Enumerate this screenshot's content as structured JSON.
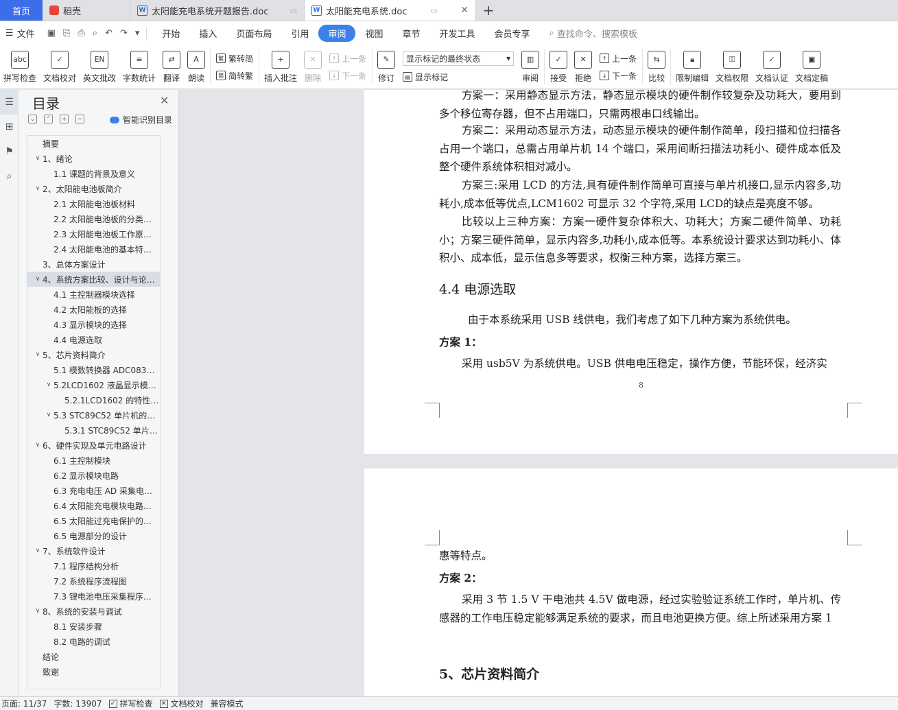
{
  "tabs": {
    "home": "首页",
    "tab1": "稻壳",
    "tab2": "太阳能充电系统开题报告.doc",
    "tab3": "太阳能充电系统.doc",
    "add": "+"
  },
  "menu": {
    "file": "文件",
    "items": [
      "开始",
      "插入",
      "页面布局",
      "引用",
      "审阅",
      "视图",
      "章节",
      "开发工具",
      "会员专享"
    ],
    "active_index": 4,
    "search": "查找命令、搜索模板"
  },
  "ribbon": {
    "spell": "拼写检查",
    "doc_check": "文档校对",
    "en_review": "英文批改",
    "word_count": "字数统计",
    "translate": "翻译",
    "read": "朗读",
    "to_trad": "繁转简",
    "to_simp": "简转繁",
    "insert_comment": "插入批注",
    "delete": "删除",
    "prev1": "上一条",
    "next1": "下一条",
    "revise": "修订",
    "markup_select": "显示标记的最终状态",
    "show_markup": "显示标记",
    "review": "审阅",
    "accept": "接受",
    "reject": "拒绝",
    "prev2": "上一条",
    "next2": "下一条",
    "compare": "比较",
    "restrict": "限制编辑",
    "doc_rights": "文档权限",
    "doc_cert": "文档认证",
    "doc_final": "文档定稿"
  },
  "toc": {
    "title": "目录",
    "smart": "智能识别目录",
    "items": [
      {
        "text": "摘要",
        "level": 1,
        "arrow": ""
      },
      {
        "text": "1、绪论",
        "level": 1,
        "arrow": "v"
      },
      {
        "text": "1.1 课题的背景及意义",
        "level": 2,
        "arrow": ""
      },
      {
        "text": "2、太阳能电池板简介",
        "level": 1,
        "arrow": "v"
      },
      {
        "text": "2.1 太阳能电池板材料",
        "level": 2,
        "arrow": ""
      },
      {
        "text": "2.2 太阳能电池板的分类…",
        "level": 2,
        "arrow": ""
      },
      {
        "text": "2.3 太阳能电池板工作原…",
        "level": 2,
        "arrow": ""
      },
      {
        "text": "2.4 太阳能电池的基本特…",
        "level": 2,
        "arrow": ""
      },
      {
        "text": "3、总体方案设计",
        "level": 1,
        "arrow": ""
      },
      {
        "text": "4、系统方案比较、设计与论…",
        "level": 1,
        "arrow": "v",
        "active": true
      },
      {
        "text": "4.1 主控制器模块选择",
        "level": 2,
        "arrow": ""
      },
      {
        "text": "4.2 太阳能板的选择",
        "level": 2,
        "arrow": ""
      },
      {
        "text": "4.3 显示模块的选择",
        "level": 2,
        "arrow": ""
      },
      {
        "text": "4.4 电源选取",
        "level": 2,
        "arrow": ""
      },
      {
        "text": "5、芯片资料简介",
        "level": 1,
        "arrow": "v"
      },
      {
        "text": "5.1 模数转换器 ADC083…",
        "level": 2,
        "arrow": ""
      },
      {
        "text": "5.2LCD1602 液晶显示模…",
        "level": 2,
        "arrow": "v"
      },
      {
        "text": "5.2.1LCD1602 的特性…",
        "level": 3,
        "arrow": ""
      },
      {
        "text": "5.3 STC89C52 单片机的…",
        "level": 2,
        "arrow": "v"
      },
      {
        "text": "5.3.1 STC89C52 单片…",
        "level": 3,
        "arrow": ""
      },
      {
        "text": "6、硬件实现及单元电路设计",
        "level": 1,
        "arrow": "v"
      },
      {
        "text": "6.1 主控制模块",
        "level": 2,
        "arrow": ""
      },
      {
        "text": "6.2 显示模块电路",
        "level": 2,
        "arrow": ""
      },
      {
        "text": "6.3 充电电压 AD 采集电…",
        "level": 2,
        "arrow": ""
      },
      {
        "text": "6.4 太阳能充电模块电路…",
        "level": 2,
        "arrow": ""
      },
      {
        "text": "6.5 太阳能过充电保护的…",
        "level": 2,
        "arrow": ""
      },
      {
        "text": "6.5 电源部分的设计",
        "level": 2,
        "arrow": ""
      },
      {
        "text": "7、系统软件设计",
        "level": 1,
        "arrow": "v"
      },
      {
        "text": "7.1 程序结构分析",
        "level": 2,
        "arrow": ""
      },
      {
        "text": "7.2 系统程序流程图",
        "level": 2,
        "arrow": ""
      },
      {
        "text": "7.3 锂电池电压采集程序…",
        "level": 2,
        "arrow": ""
      },
      {
        "text": "8、系统的安装与调试",
        "level": 1,
        "arrow": "v"
      },
      {
        "text": "8.1 安装步骤",
        "level": 2,
        "arrow": ""
      },
      {
        "text": "8.2 电路的调试",
        "level": 2,
        "arrow": ""
      },
      {
        "text": "结论",
        "level": 1,
        "arrow": ""
      },
      {
        "text": "致谢",
        "level": 1,
        "arrow": ""
      }
    ]
  },
  "page1": {
    "p1": "方案一：采用静态显示方法，静态显示模块的硬件制作较复杂及功耗大，要用到多个移位寄存器，但不占用端口，只需两根串口线输出。",
    "p2": "方案二：采用动态显示方法，动态显示模块的硬件制作简单，段扫描和位扫描各占用一个端口，总需占用单片机 14 个端口，采用间断扫描法功耗小、硬件成本低及整个硬件系统体积相对减小。",
    "p3": "方案三:采用 LCD 的方法,具有硬件制作简单可直接与单片机接口,显示内容多,功耗小,成本低等优点,LCM1602 可显示 32 个字符,采用 LCD的缺点是亮度不够。",
    "p4": "比较以上三种方案：方案一硬件复杂体积大、功耗大；方案二硬件简单、功耗小；方案三硬件简单，显示内容多,功耗小,成本低等。本系统设计要求达到功耗小、体积小、成本低，显示信息多等要求，权衡三种方案，选择方案三。",
    "heading": "4.4 电源选取",
    "p5": "由于本系统采用 USB 线供电，我们考虑了如下几种方案为系统供电。",
    "label1": "方案 1：",
    "p6": "采用 usb5V 为系统供电。USB 供电电压稳定，操作方便，节能环保，经济实",
    "page_number": "8"
  },
  "page2": {
    "p1": "惠等特点。",
    "label2": "方案 2：",
    "p2": "采用 3 节 1.5 V 干电池共 4.5V 做电源，经过实验验证系统工作时，单片机、传感器的工作电压稳定能够满足系统的要求，而且电池更换方便。综上所述采用方案 1",
    "heading": "5、芯片资料简介"
  },
  "status": {
    "page": "页面: 11/37",
    "words": "字数: 13907",
    "spell": "拼写检查",
    "doc_check": "文档校对",
    "compat": "兼容模式"
  }
}
